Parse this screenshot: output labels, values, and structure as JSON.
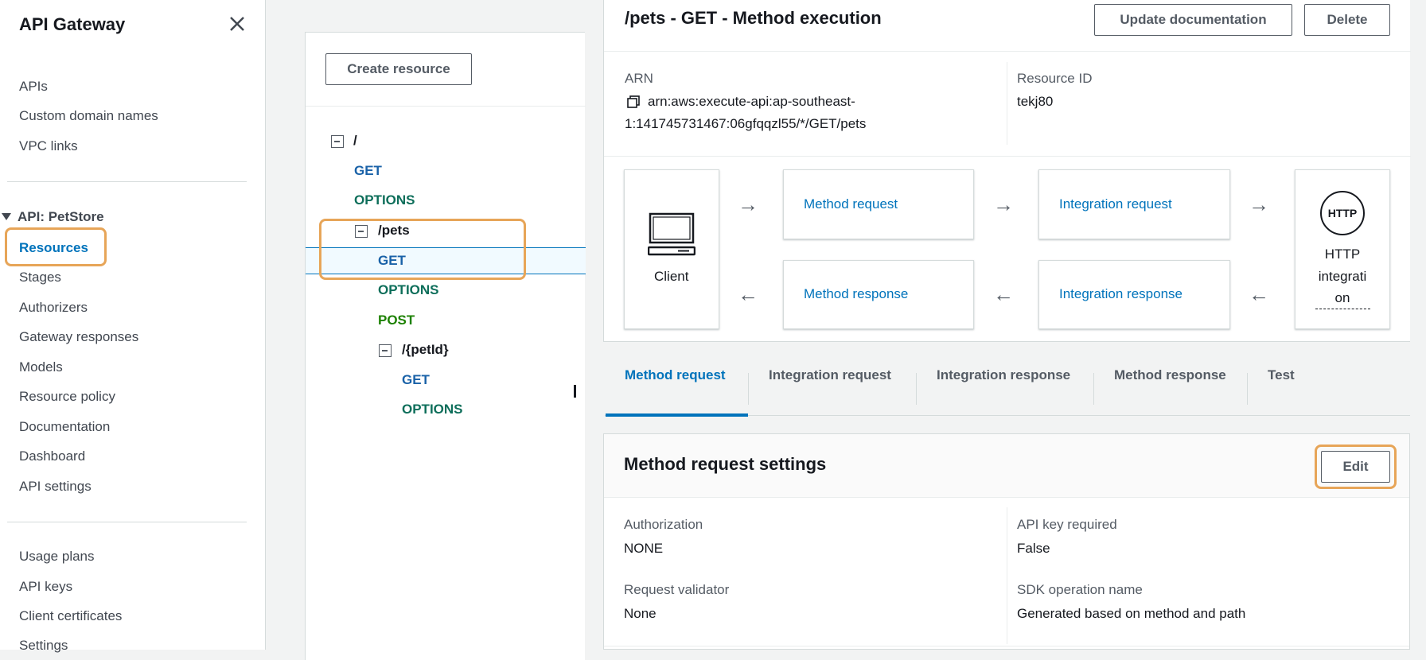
{
  "sidebar": {
    "title": "API Gateway",
    "top_items": [
      "APIs",
      "Custom domain names",
      "VPC links"
    ],
    "api_section": "API: PetStore",
    "api_items": [
      "Resources",
      "Stages",
      "Authorizers",
      "Gateway responses",
      "Models",
      "Resource policy",
      "Documentation",
      "Dashboard",
      "API settings"
    ],
    "bottom_items": [
      "Usage plans",
      "API keys",
      "Client certificates",
      "Settings"
    ],
    "active_item": "Resources"
  },
  "tree": {
    "create_button": "Create resource",
    "nodes": [
      {
        "label": "/",
        "kind": "resource"
      },
      {
        "label": "GET",
        "kind": "method"
      },
      {
        "label": "OPTIONS",
        "kind": "method"
      },
      {
        "label": "/pets",
        "kind": "resource"
      },
      {
        "label": "GET",
        "kind": "method",
        "selected": true
      },
      {
        "label": "OPTIONS",
        "kind": "method"
      },
      {
        "label": "POST",
        "kind": "method"
      },
      {
        "label": "/{petId}",
        "kind": "resource"
      },
      {
        "label": "GET",
        "kind": "method"
      },
      {
        "label": "OPTIONS",
        "kind": "method"
      }
    ]
  },
  "header": {
    "title": "/pets - GET - Method execution",
    "update_doc_button": "Update documentation",
    "delete_button": "Delete",
    "arn_label": "ARN",
    "arn_line1": "arn:aws:execute-api:ap-southeast-",
    "arn_line2": "1:141745731467:06gfqqzl55/*/GET/pets",
    "resource_id_label": "Resource ID",
    "resource_id": "tekj80"
  },
  "flow": {
    "client": "Client",
    "method_request": "Method request",
    "integration_request": "Integration request",
    "method_response": "Method response",
    "integration_response": "Integration response",
    "http_badge": "HTTP",
    "http_line1": "HTTP",
    "http_line2": "integrati",
    "http_line3": "on"
  },
  "tabs": [
    "Method request",
    "Integration request",
    "Integration response",
    "Method response",
    "Test"
  ],
  "active_tab": "Method request",
  "settings": {
    "title": "Method request settings",
    "edit_button": "Edit",
    "authorization_label": "Authorization",
    "authorization": "NONE",
    "api_key_label": "API key required",
    "api_key": "False",
    "validator_label": "Request validator",
    "validator": "None",
    "sdk_label": "SDK operation name",
    "sdk": "Generated based on method and path"
  },
  "colors": {
    "accent": "#0073bb",
    "highlight": "#e7a558",
    "get_method": "#1a62a8",
    "options_method": "#0d6e5a",
    "post_method": "#1d8102"
  }
}
